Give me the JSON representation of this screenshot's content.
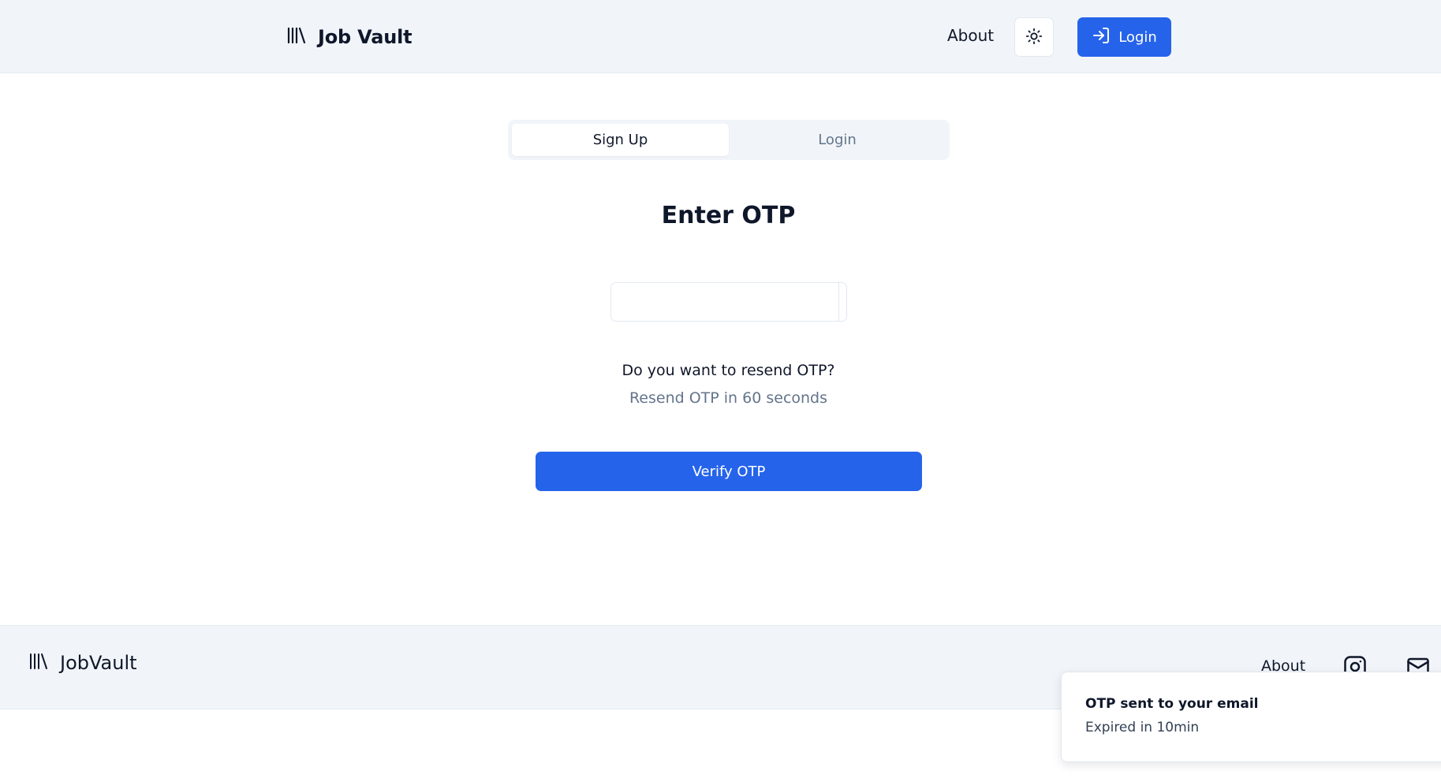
{
  "header": {
    "brand": "Job Vault",
    "logo_icon": "library-icon",
    "nav_about": "About",
    "theme_icon": "sun-icon",
    "login_label": "Login",
    "login_icon": "login-arrow-icon"
  },
  "auth": {
    "tabs": [
      {
        "label": "Sign Up",
        "active": true
      },
      {
        "label": "Login",
        "active": false
      }
    ],
    "title": "Enter OTP",
    "otp_slots": [
      "",
      "",
      "",
      "",
      "",
      ""
    ],
    "resend_question": "Do you want to resend OTP?",
    "resend_timer": "Resend OTP in 60 seconds",
    "verify_label": "Verify OTP"
  },
  "footer": {
    "brand": "JobVault",
    "about": "About",
    "icons": [
      "instagram-icon",
      "mail-icon"
    ]
  },
  "toast": {
    "title": "OTP sent to your email",
    "description": "Expired in 10min"
  },
  "colors": {
    "accent": "#2563eb",
    "header_bg": "#f1f5f9",
    "muted_text": "#64748b"
  }
}
